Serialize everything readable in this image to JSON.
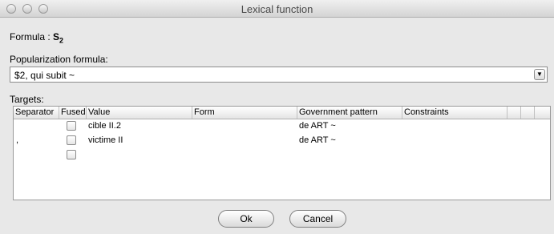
{
  "window": {
    "title": "Lexical function"
  },
  "formula": {
    "label": "Formula :",
    "value_main": "S",
    "value_sub": "2"
  },
  "popularization": {
    "label": "Popularization formula:",
    "selected": "$2, qui subit ~"
  },
  "targets": {
    "label": "Targets:",
    "columns": [
      "Separator",
      "Fused",
      "Value",
      "Form",
      "Government pattern",
      "Constraints"
    ],
    "rows": [
      {
        "separator": "",
        "fused": false,
        "value": "cible II.2",
        "form": "",
        "government_pattern": "de ART ~",
        "constraints": ""
      },
      {
        "separator": ",",
        "fused": false,
        "value": "victime II",
        "form": "",
        "government_pattern": "de ART ~",
        "constraints": ""
      },
      {
        "separator": "",
        "fused": false,
        "value": "",
        "form": "",
        "government_pattern": "",
        "constraints": ""
      }
    ]
  },
  "buttons": {
    "ok": "Ok",
    "cancel": "Cancel"
  }
}
